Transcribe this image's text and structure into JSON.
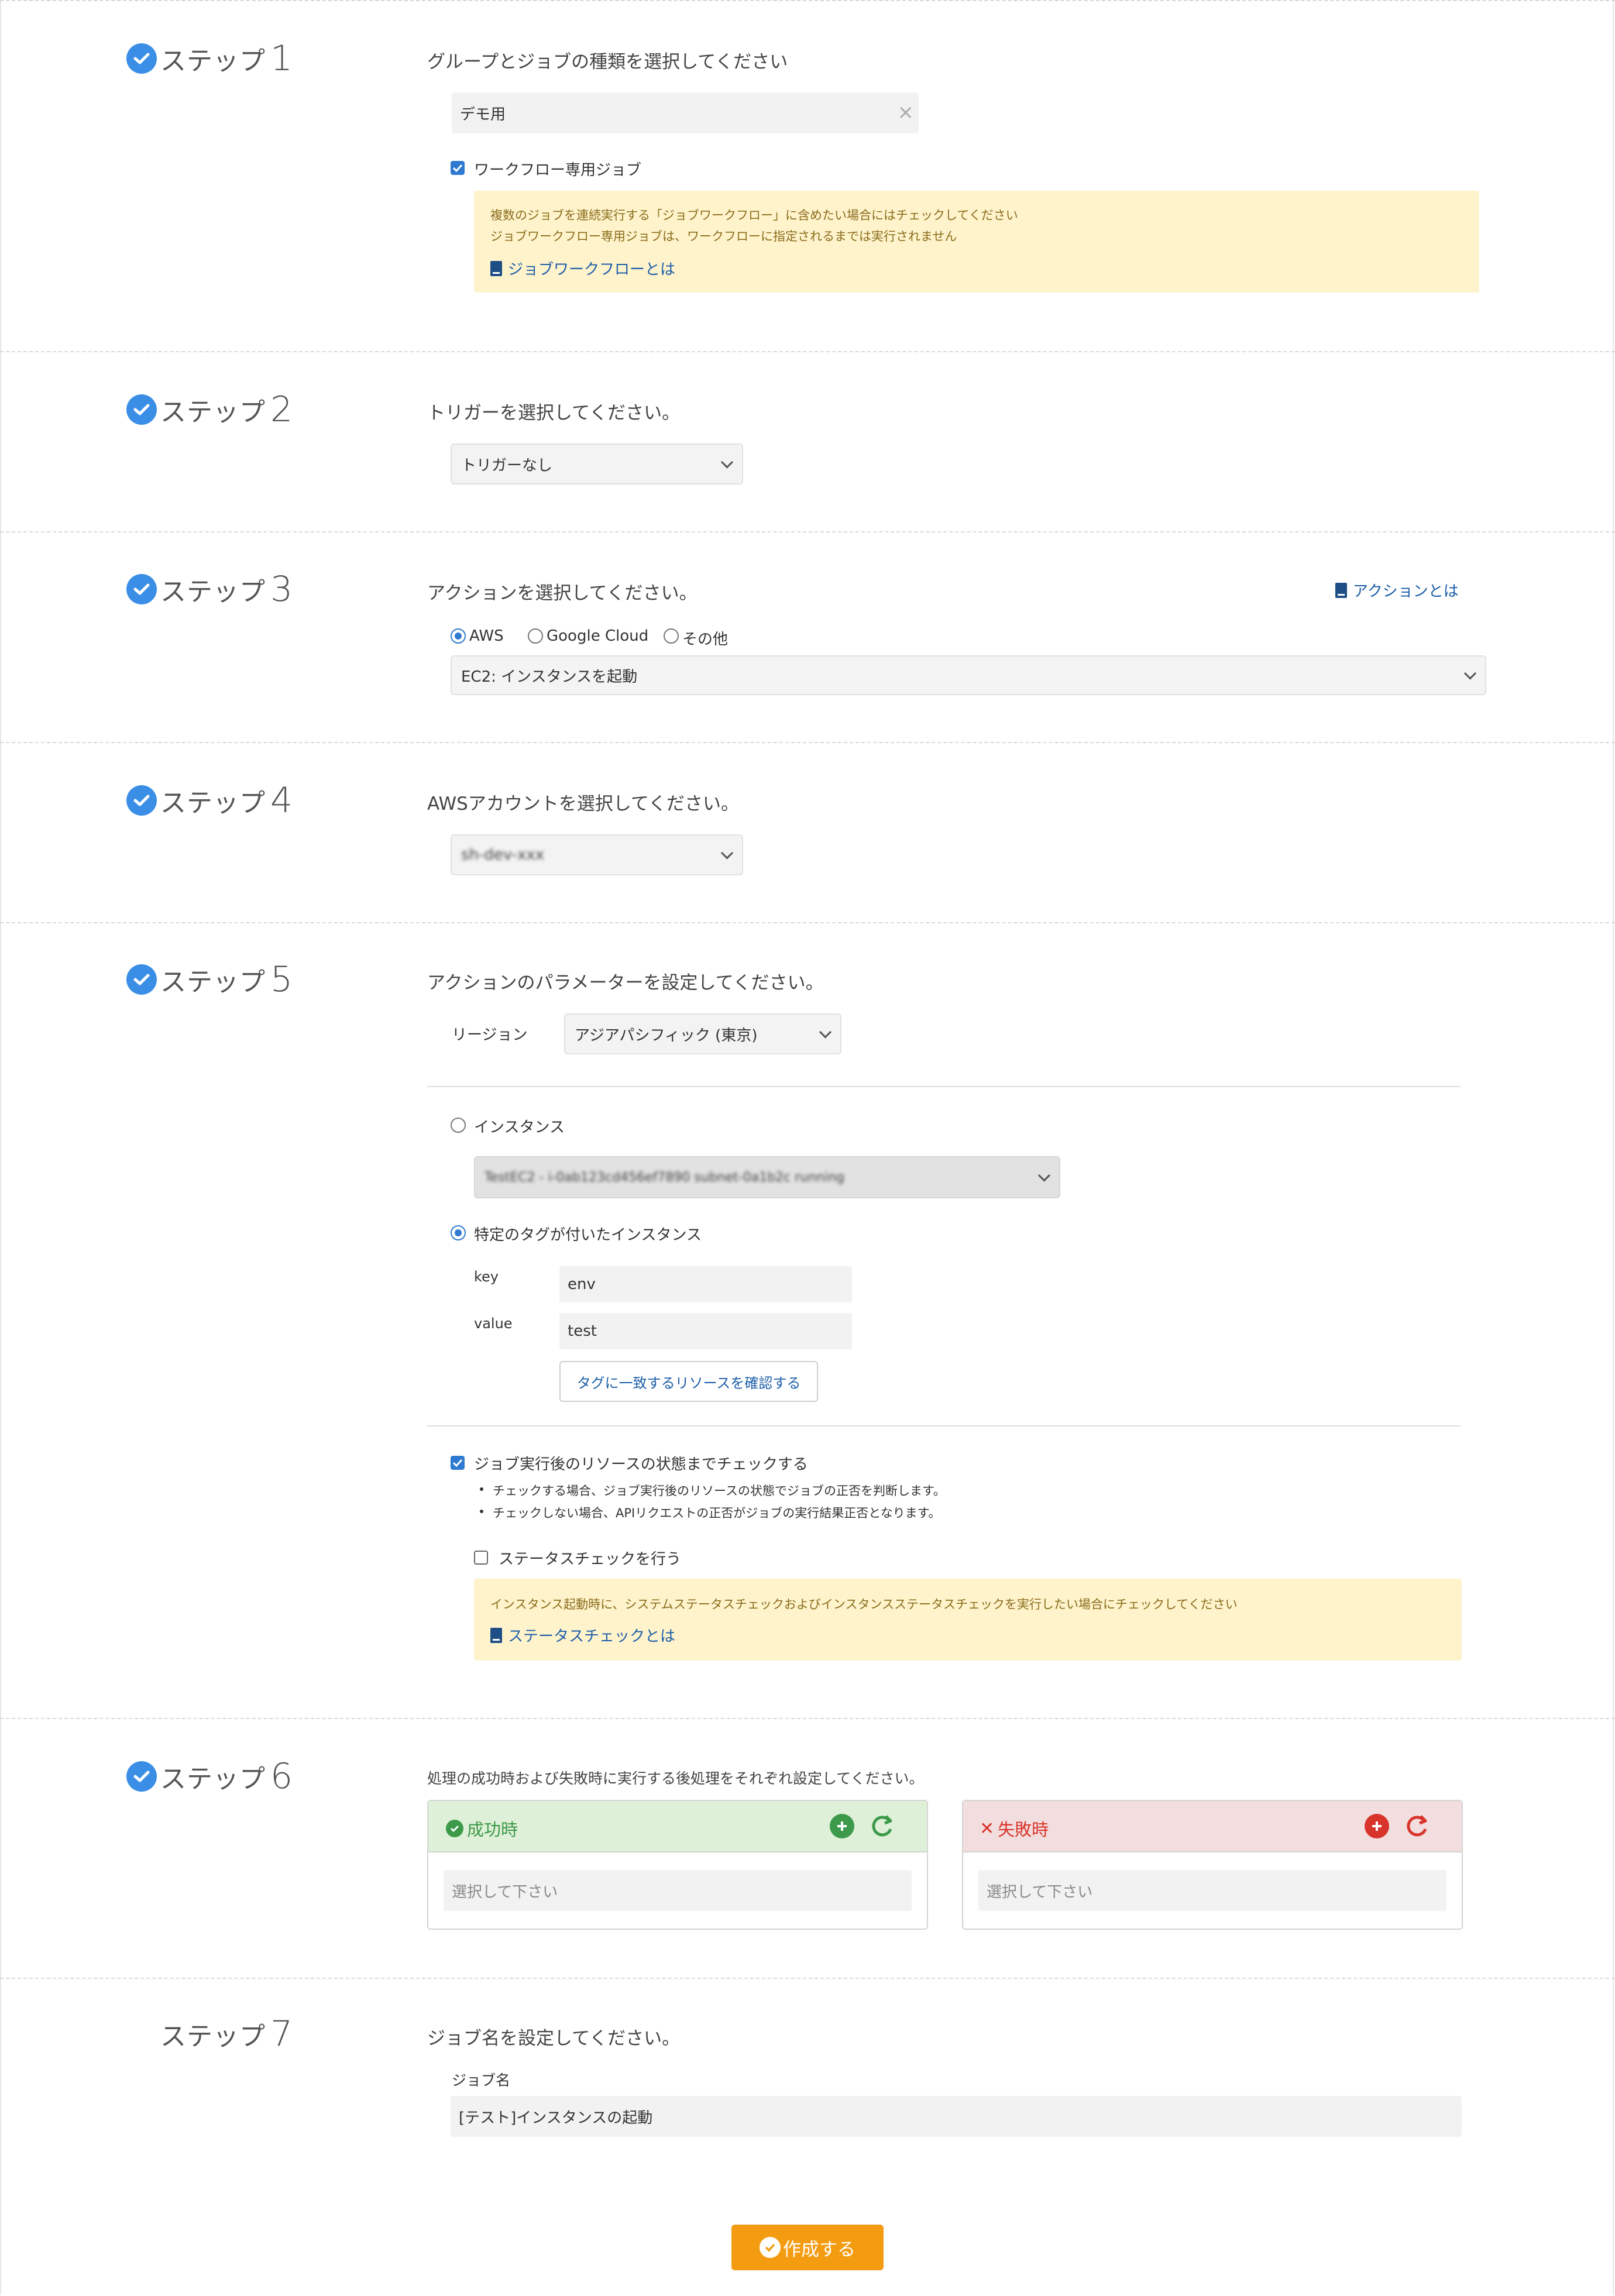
{
  "steps": [
    {
      "label": "ステップ",
      "num": "1",
      "done": true,
      "prompt": "グループとジョブの種類を選択してください"
    },
    {
      "label": "ステップ",
      "num": "2",
      "done": true,
      "prompt": "トリガーを選択してください。"
    },
    {
      "label": "ステップ",
      "num": "3",
      "done": true,
      "prompt": "アクションを選択してください。"
    },
    {
      "label": "ステップ",
      "num": "4",
      "done": true,
      "prompt": "AWSアカウントを選択してください。"
    },
    {
      "label": "ステップ",
      "num": "5",
      "done": true,
      "prompt": "アクションのパラメーターを設定してください。"
    },
    {
      "label": "ステップ",
      "num": "6",
      "done": true,
      "prompt": "処理の成功時および失敗時に実行する後処理をそれぞれ設定してください。"
    },
    {
      "label": "ステップ",
      "num": "7",
      "done": false,
      "prompt": "ジョブ名を設定してください。"
    }
  ],
  "step1": {
    "group_value": "デモ用",
    "workflow_checkbox_label": "ワークフロー専用ジョブ",
    "workflow_checked": true,
    "note_line1": "複数のジョブを連続実行する「ジョブワークフロー」に含めたい場合にはチェックしてください",
    "note_line2": "ジョブワークフロー専用ジョブは、ワークフローに指定されるまでは実行されません",
    "note_link": "ジョブワークフローとは"
  },
  "step2": {
    "trigger_value": "トリガーなし"
  },
  "step3": {
    "help_link": "アクションとは",
    "providers": [
      "AWS",
      "Google Cloud",
      "その他"
    ],
    "selected_provider": "AWS",
    "action_value": "EC2: インスタンスを起動"
  },
  "step4": {
    "account_value": "sh-dev-xxx"
  },
  "step5": {
    "region_label": "リージョン",
    "region_value": "アジアパシフィック (東京)",
    "instance_radio_label": "インスタンス",
    "instance_value": "TestEC2 - i-0ab123cd456ef7890 subnet-0a1b2c running",
    "tag_radio_label": "特定のタグが付いたインスタンス",
    "key_label": "key",
    "key_value": "env",
    "value_label": "value",
    "value_value": "test",
    "confirm_button": "タグに一致するリソースを確認する",
    "check_after_label": "ジョブ実行後のリソースの状態までチェックする",
    "check_after_checked": true,
    "bullets": [
      "チェックする場合、ジョブ実行後のリソースの状態でジョブの正否を判断します。",
      "チェックしない場合、APIリクエストの正否がジョブの実行結果正否となります。"
    ],
    "status_check_label": "ステータスチェックを行う",
    "status_check_checked": false,
    "note_text": "インスタンス起動時に、システムステータスチェックおよびインスタンスステータスチェックを実行したい場合にチェックしてください",
    "note_link": "ステータスチェックとは"
  },
  "step6": {
    "success_title": "成功時",
    "failure_title": "失敗時",
    "success_placeholder": "選択して下さい",
    "failure_placeholder": "選択して下さい",
    "colors": {
      "success_bg": "#dff0d8",
      "success_fg": "#3c9a4a",
      "failure_bg": "#f2dede",
      "failure_fg": "#d9342b"
    }
  },
  "step7": {
    "jobname_label": "ジョブ名",
    "jobname_value": "[テスト]インスタンスの起動"
  },
  "submit_label": "作成する",
  "colors": {
    "accent": "#3a8ee6",
    "submit": "#f39c12",
    "note_bg": "#fff3cc",
    "link": "#1d5fa8"
  }
}
